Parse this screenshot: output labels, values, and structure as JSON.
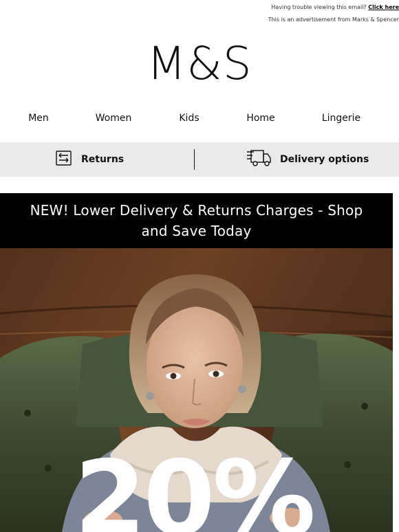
{
  "topbar": {
    "trouble_text": "Having trouble viewing this email?",
    "click_here": "Click here",
    "advert_text": "This is an advertisement from Marks & Spencer"
  },
  "brand": {
    "logo": "M&S"
  },
  "nav": {
    "items": [
      {
        "label": "Men"
      },
      {
        "label": "Women"
      },
      {
        "label": "Kids"
      },
      {
        "label": "Home"
      },
      {
        "label": "Lingerie"
      }
    ]
  },
  "services": {
    "returns": {
      "label": "Returns",
      "icon": "returns-icon"
    },
    "delivery": {
      "label": "Delivery options",
      "icon": "delivery-van-icon"
    }
  },
  "promo": {
    "headline": "NEW! Lower Delivery & Returns Charges - Shop and Save Today"
  },
  "hero": {
    "offer_text": "20%",
    "colors": {
      "panel": "#6b3f22",
      "chair": "#4c5a3b",
      "fur": "#e4d9cc",
      "sweater": "#7d8697"
    }
  }
}
